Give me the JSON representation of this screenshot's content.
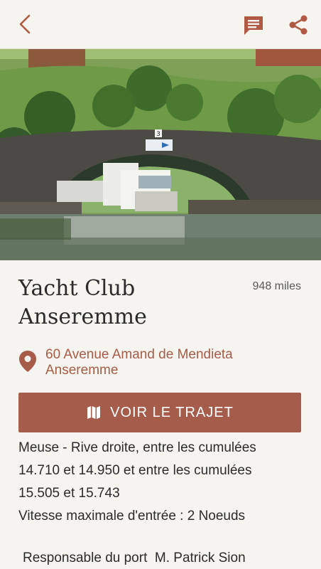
{
  "header": {
    "back_icon": "chevron-left-icon",
    "chat_icon": "message-icon",
    "share_icon": "share-icon",
    "accent": "#b05a45"
  },
  "hero": {
    "bridge_sign": "3"
  },
  "place": {
    "name_line1": "Yacht Club",
    "name_line2": "Anseremme",
    "distance": "948 miles"
  },
  "address": {
    "line1": "60 Avenue Amand de Mendieta",
    "line2": "Anseremme",
    "color": "#a75b49"
  },
  "route_button": {
    "label": "VOIR LE TRAJET",
    "icon": "map-icon",
    "color": "#a55c4b"
  },
  "description": {
    "line1": "Meuse - Rive droite, entre les cumulées",
    "line2": "14.710 et 14.950 et entre les cumulées",
    "line3": "15.505 et 15.743",
    "line4": "Vitesse maximale d'entrée : 2 Noeuds"
  },
  "manager": {
    "text": "Responsable du port  M. Patrick Sion"
  }
}
